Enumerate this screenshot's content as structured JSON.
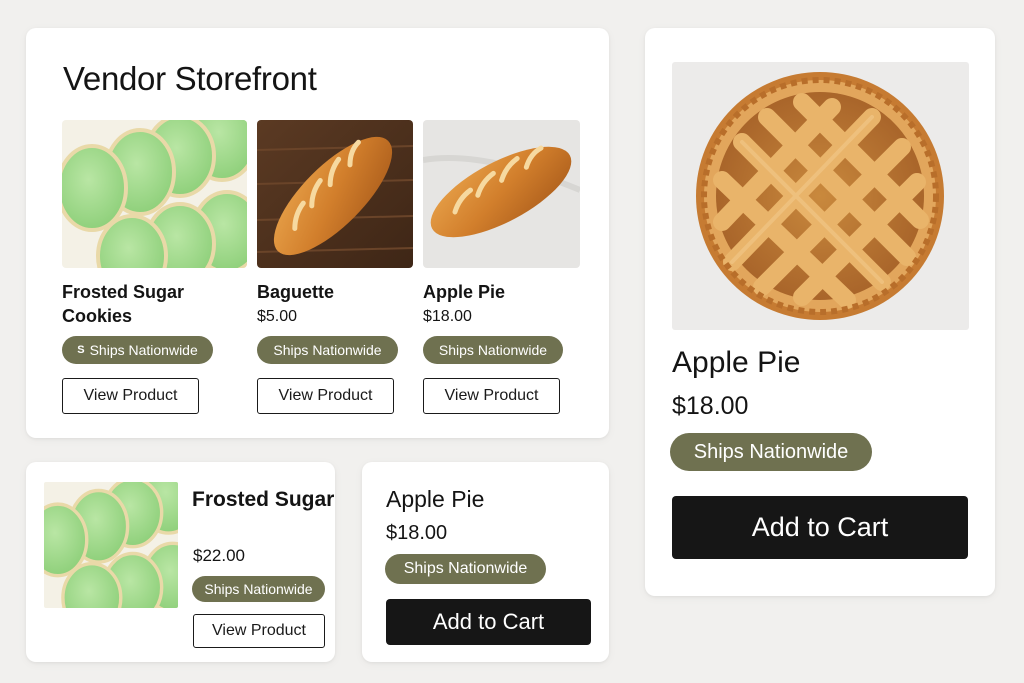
{
  "storefront": {
    "title": "Vendor Storefront",
    "products": [
      {
        "name": "Frosted Sugar Cookies",
        "price": "",
        "badge": "Ships Nationwide",
        "button": "View Product",
        "image": "green-frosted-sugar-cookies"
      },
      {
        "name": "Baguette",
        "price": "$5.00",
        "badge": "Ships Nationwide",
        "button": "View Product",
        "image": "baguette-on-wood"
      },
      {
        "name": "Apple Pie",
        "price": "$18.00",
        "badge": "Ships Nationwide",
        "button": "View Product",
        "image": "baguette-on-marble"
      }
    ],
    "badge_icon": "ships-icon"
  },
  "detail": {
    "name": "Apple Pie",
    "price": "$18.00",
    "badge": "Ships Nationwide",
    "button": "Add to Cart",
    "image": "lattice-apple-pie"
  },
  "cookie_card": {
    "name": "Frosted Sugar Cookies",
    "price": "$22.00",
    "badge": "Ships Nationwide",
    "button": "View Product",
    "image": "green-frosted-sugar-cookies"
  },
  "pie_card": {
    "name": "Apple Pie",
    "price": "$18.00",
    "badge": "Ships Nationwide",
    "button": "Add to Cart"
  },
  "colors": {
    "badge": "#6f7150",
    "dark_button": "#161616",
    "page_bg": "#f1f0ee"
  }
}
